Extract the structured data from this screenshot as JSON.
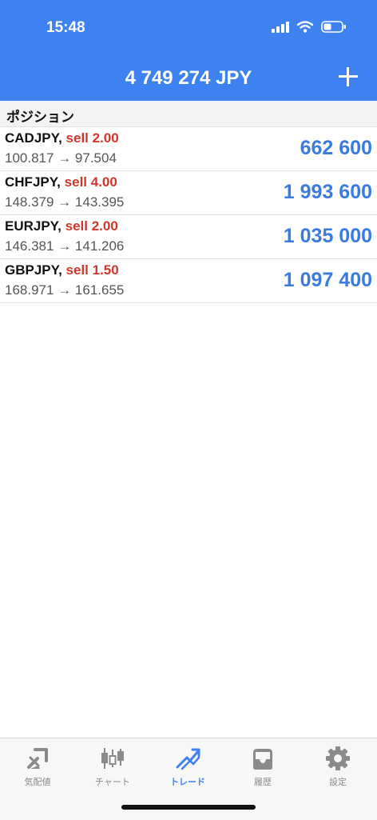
{
  "status_bar": {
    "time": "15:48"
  },
  "header": {
    "balance": "4 749 274 JPY"
  },
  "section": {
    "title": "ポジション"
  },
  "positions": [
    {
      "symbol": "CADJPY,",
      "side": "sell 2.00",
      "open_price": "100.817",
      "current_price": "97.504",
      "profit": "662 600"
    },
    {
      "symbol": "CHFJPY,",
      "side": "sell 4.00",
      "open_price": "148.379",
      "current_price": "143.395",
      "profit": "1 993 600"
    },
    {
      "symbol": "EURJPY,",
      "side": "sell 2.00",
      "open_price": "146.381",
      "current_price": "141.206",
      "profit": "1 035 000"
    },
    {
      "symbol": "GBPJPY,",
      "side": "sell 1.50",
      "open_price": "168.971",
      "current_price": "161.655",
      "profit": "1 097 400"
    }
  ],
  "arrow": "→",
  "tabs": [
    {
      "label": "気配値",
      "icon": "quotes-icon"
    },
    {
      "label": "チャート",
      "icon": "chart-icon"
    },
    {
      "label": "トレード",
      "icon": "trade-icon",
      "active": true
    },
    {
      "label": "履歴",
      "icon": "history-icon"
    },
    {
      "label": "設定",
      "icon": "settings-icon"
    }
  ],
  "colors": {
    "accent": "#3d82f0",
    "sell": "#d0362b",
    "profit": "#3a7be0"
  }
}
